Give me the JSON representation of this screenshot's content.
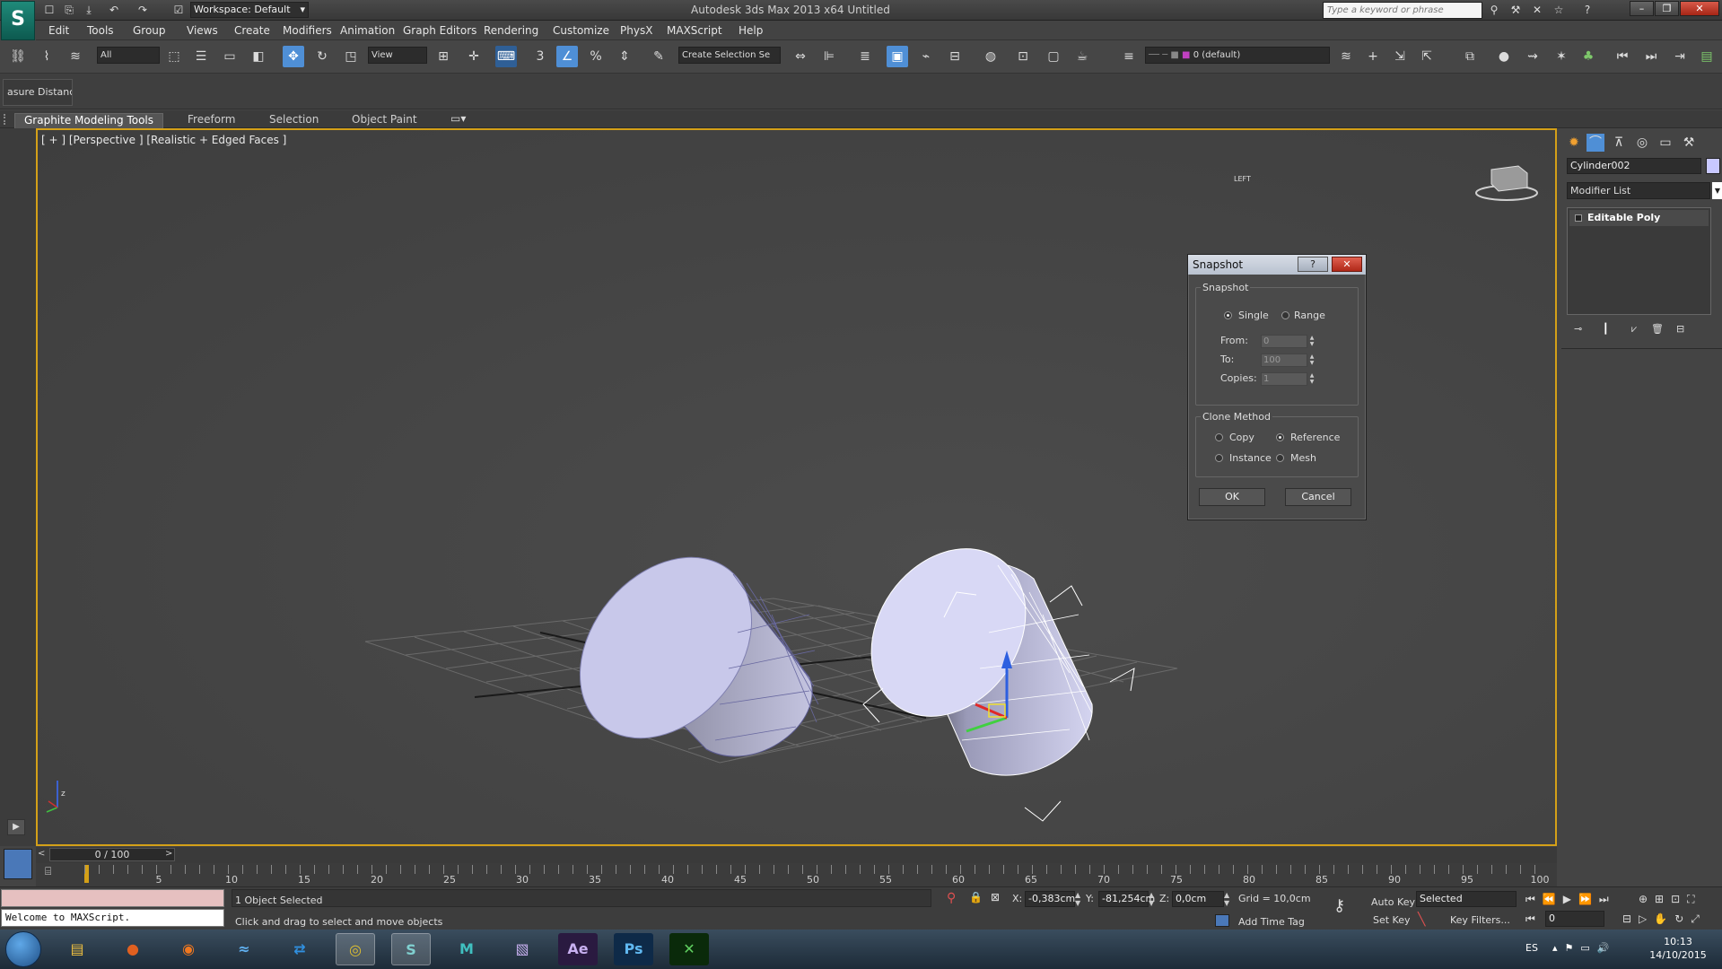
{
  "titlebar": {
    "logo": "S",
    "quick_access": [
      "☐",
      "⎘",
      "⤓",
      "↶",
      "↷",
      "☑"
    ],
    "workspace": "Workspace: Default",
    "app_title": "Autodesk 3ds Max  2013 x64      Untitled",
    "search_placeholder": "Type a keyword or phrase",
    "window_buttons": [
      "–",
      "❐",
      "✕"
    ]
  },
  "menubar": {
    "items": [
      "Edit",
      "Tools",
      "Group",
      "Views",
      "Create",
      "Modifiers",
      "Animation",
      "Graph Editors",
      "Rendering",
      "Customize",
      "PhysX",
      "MAXScript",
      "Help"
    ]
  },
  "toolbar": {
    "selection_filter": "All",
    "ref_coord": "View",
    "named_selection": "Create Selection Se",
    "layer": "0 (default)"
  },
  "toolbar2": {
    "measure_label": "asure Distance"
  },
  "ribbon": {
    "tabs": [
      "Graphite Modeling Tools",
      "Freeform",
      "Selection",
      "Object Paint"
    ]
  },
  "viewport": {
    "label": "[ + ] [Perspective ] [Realistic + Edged Faces ]"
  },
  "command_panel": {
    "object_name": "Cylinder002",
    "modifier_list": "Modifier List",
    "stack_item": "Editable Poly",
    "object_color": "#c8c8ff"
  },
  "dialog": {
    "title": "Snapshot",
    "help": "?",
    "close": "✕",
    "snapshot_group": "Snapshot",
    "single": "Single",
    "range": "Range",
    "from_label": "From:",
    "from_value": "0",
    "to_label": "To:",
    "to_value": "100",
    "copies_label": "Copies:",
    "copies_value": "1",
    "clone_group": "Clone Method",
    "copy": "Copy",
    "reference": "Reference",
    "instance": "Instance",
    "mesh": "Mesh",
    "ok": "OK",
    "cancel": "Cancel"
  },
  "timeline": {
    "frame": "0 / 100",
    "ticks": [
      "5",
      "10",
      "15",
      "20",
      "25",
      "30",
      "35",
      "40",
      "45",
      "50",
      "55",
      "60",
      "65",
      "70",
      "75",
      "80",
      "85",
      "90",
      "95",
      "100"
    ]
  },
  "status": {
    "maxscript": "Welcome to MAXScript.",
    "selected": "1 Object Selected",
    "prompt": "Click and drag to select and move objects",
    "x_label": "X:",
    "x_value": "-0,383cm",
    "y_label": "Y:",
    "y_value": "-81,254cm",
    "z_label": "Z:",
    "z_value": "0,0cm",
    "grid": "Grid = 10,0cm",
    "add_time_tag": "Add Time Tag",
    "auto_key": "Auto Key",
    "set_key": "Set Key",
    "key_mode": "Selected",
    "key_filters": "Key Filters...",
    "frame_field": "0"
  },
  "taskbar": {
    "apps": [
      "explorer",
      "firefox",
      "avast",
      "teamviewer",
      "chrome",
      "3dsmax",
      "maya",
      "premiere",
      "after-effects",
      "photoshop",
      "camtasia"
    ],
    "app_labels": [
      "▤",
      "●",
      "◉",
      "≈",
      "⇄",
      "◎",
      "S",
      "M",
      "▧",
      "Ae",
      "Ps",
      "✕"
    ],
    "lang": "ES",
    "time": "10:13",
    "date": "14/10/2015"
  }
}
